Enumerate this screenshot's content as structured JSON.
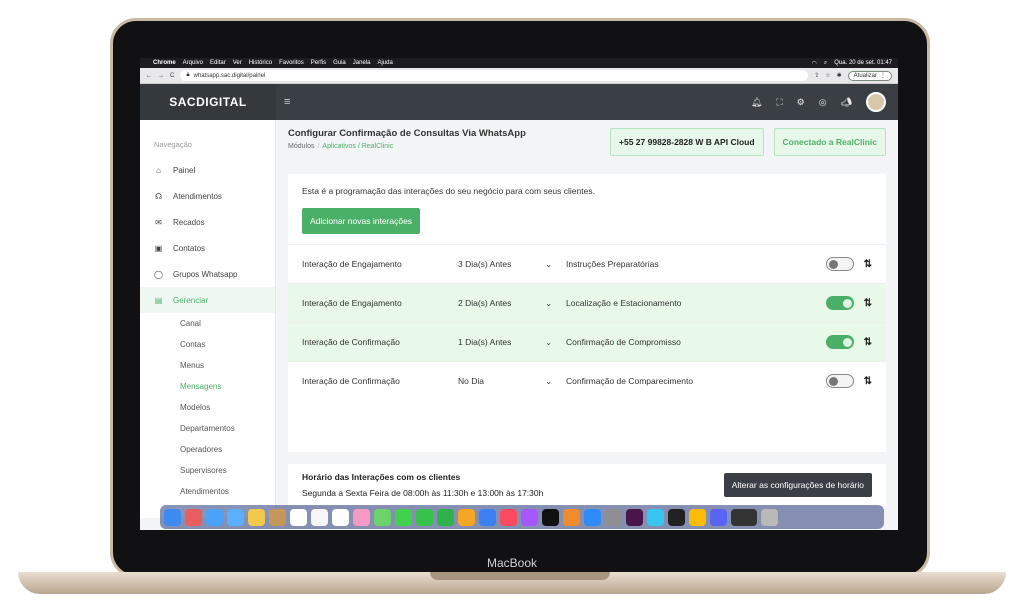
{
  "mac_menubar": {
    "items": [
      "Chrome",
      "Arquivo",
      "Editar",
      "Ver",
      "Histórico",
      "Favoritos",
      "Perfis",
      "Guia",
      "Janela",
      "Ajuda"
    ],
    "clock": "Qua. 20 de set.  01:47"
  },
  "browser": {
    "url": "whatsapp.sac.digital/painel",
    "update_label": "Atualizar"
  },
  "app": {
    "logo": "SACDIGITAL",
    "menu_icon": "≡"
  },
  "sidebar": {
    "heading": "Navegação",
    "items": [
      {
        "label": "Painel",
        "icon": "home-icon"
      },
      {
        "label": "Atendimentos",
        "icon": "headset-icon"
      },
      {
        "label": "Recados",
        "icon": "envelope-icon"
      },
      {
        "label": "Contatos",
        "icon": "contact-card-icon"
      },
      {
        "label": "Grupos Whatsapp",
        "icon": "whatsapp-icon"
      },
      {
        "label": "Gerenciar",
        "icon": "database-icon"
      }
    ],
    "subitems": [
      "Canal",
      "Contas",
      "Menus",
      "Mensagens",
      "Modelos",
      "Departamentos",
      "Operadores",
      "Supervisores",
      "Atendimentos"
    ]
  },
  "page": {
    "title": "Configurar Confirmação de Consultas Via WhatsApp",
    "breadcrumb": {
      "root": "Módulos",
      "sep": "/",
      "link": "Aplicativos / RealClinic"
    },
    "phone_badge": "+55 27 99828-2828 W B API Cloud",
    "connected_badge": "Conectado a RealClinic",
    "intro": "Esta é a programação das interações do seu negócio para com seus clientes.",
    "add_button": "Adicionar novas interações"
  },
  "interactions": [
    {
      "type": "Interação de Engajamento",
      "timing": "3 Dia(s) Antes",
      "message": "Instruções Preparatórias",
      "enabled": false
    },
    {
      "type": "Interação de Engajamento",
      "timing": "2 Dia(s) Antes",
      "message": "Localização e Estacionamento",
      "enabled": true
    },
    {
      "type": "Interação de Confirmação",
      "timing": "1 Dia(s) Antes",
      "message": "Confirmação de Compromisso",
      "enabled": true
    },
    {
      "type": "Interação de Confirmação",
      "timing": "No Dia",
      "message": "Confirmação de Comparecimento",
      "enabled": false
    }
  ],
  "hours": {
    "title": "Horário das Interações com os clientes",
    "text": "Segunda a Sexta Feira de 08:00h às 11:30h e 13:00h às 17:30h",
    "button": "Alterar as configurações de horário"
  },
  "laptop_brand": "MacBook",
  "colors": {
    "accent": "#4bb067",
    "header": "#3a3f45",
    "highlight_row": "#e8f8e9"
  }
}
